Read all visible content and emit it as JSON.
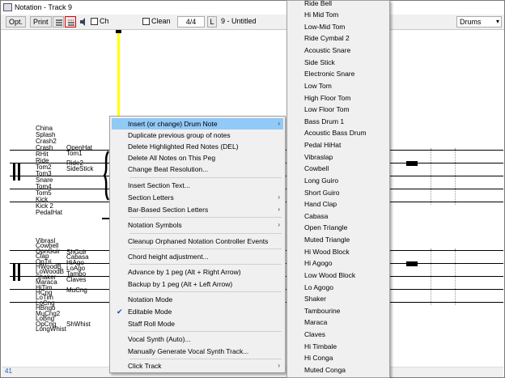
{
  "window": {
    "title": "Notation - Track 9"
  },
  "toolbar": {
    "opt_label": "Opt.",
    "print_label": "Print",
    "ch_label": "Ch",
    "clean_label": "Clean",
    "time_sig": "4/4",
    "l_label": "L",
    "song_title": "9 - Untitled",
    "part_select": "Drums"
  },
  "notation": {
    "upper_left_labels": [
      "China",
      "Splash",
      "Crash2",
      "Crash",
      "RHit",
      "Ride",
      "Tom2",
      "Tom3",
      "Snare",
      "Tom4",
      "Tom5",
      "Kick",
      "Kick 2",
      "PedalHat"
    ],
    "upper_right_labels": [
      "OpenHat",
      "Tom1",
      "Ride2",
      "SideStick"
    ],
    "lower_left_labels": [
      "Vibrasl",
      "Cowbell",
      "OpnGuir",
      "Clap",
      "OpTri",
      "HWoodB",
      "LoWoodB",
      "Shaker",
      "Maraca",
      "HiTim",
      "HCng",
      "LoTim",
      "LoCng",
      "HBngo",
      "MuCng2",
      "LoBng",
      "OpCng",
      "LongWhist"
    ],
    "lower_right_labels": [
      "ShGuir",
      "Cabasa",
      "HiAgo",
      "LoAgo",
      "Tambo",
      "Claves",
      "MuCng",
      "ShWhist"
    ],
    "track_number": "41"
  },
  "context_menu": {
    "items": [
      {
        "label": "Insert (or change) Drum Note",
        "submenu": true,
        "highlighted": true
      },
      {
        "label": "Duplicate previous group of notes"
      },
      {
        "label": "Delete Highlighted Red Notes  (DEL)"
      },
      {
        "label": "Delete All Notes on This Peg"
      },
      {
        "label": "Change Beat Resolution..."
      },
      {
        "label": "Insert Section Text..."
      },
      {
        "label": "Section Letters",
        "submenu": true
      },
      {
        "label": "Bar-Based Section Letters",
        "submenu": true
      },
      {
        "label": "Notation Symbols",
        "submenu": true
      },
      {
        "label": "Cleanup Orphaned Notation Controller Events"
      },
      {
        "label": "Chord height adjustment..."
      },
      {
        "label": "Advance by 1 peg   (Alt + Right Arrow)"
      },
      {
        "label": "Backup by 1 peg    (Alt + Left Arrow)"
      },
      {
        "label": "Notation Mode"
      },
      {
        "label": "Editable Mode",
        "checked": true
      },
      {
        "label": "Staff Roll Mode"
      },
      {
        "label": "Vocal Synth (Auto)..."
      },
      {
        "label": "Manually Generate Vocal Synth Track..."
      },
      {
        "label": "Click Track",
        "submenu": true
      }
    ]
  },
  "drum_submenu": {
    "items": [
      "Ride Bell",
      "Hi Mid Tom",
      "Low-Mid Tom",
      "Ride Cymbal 2",
      "Acoustic Snare",
      "Side Stick",
      "Electronic Snare",
      "Low Tom",
      "High Floor Tom",
      "Low Floor Tom",
      "Bass Drum 1",
      "Acoustic Bass Drum",
      "Pedal HiHat",
      "Vibraslap",
      "Cowbell",
      "Long Guiro",
      "Short Guiro",
      "Hand Clap",
      "Cabasa",
      "Open Triangle",
      "Muted Triangle",
      "Hi Wood Block",
      "Hi Agogo",
      "Low Wood Block",
      "Lo Agogo",
      "Shaker",
      "Tambourine",
      "Maraca",
      "Claves",
      "Hi Timbale",
      "Hi Conga",
      "Muted Conga"
    ]
  },
  "colors": {
    "highlight": "#91c9f7",
    "playhead": "#ffff00",
    "toolbar_bg": "#f0f0f0"
  }
}
